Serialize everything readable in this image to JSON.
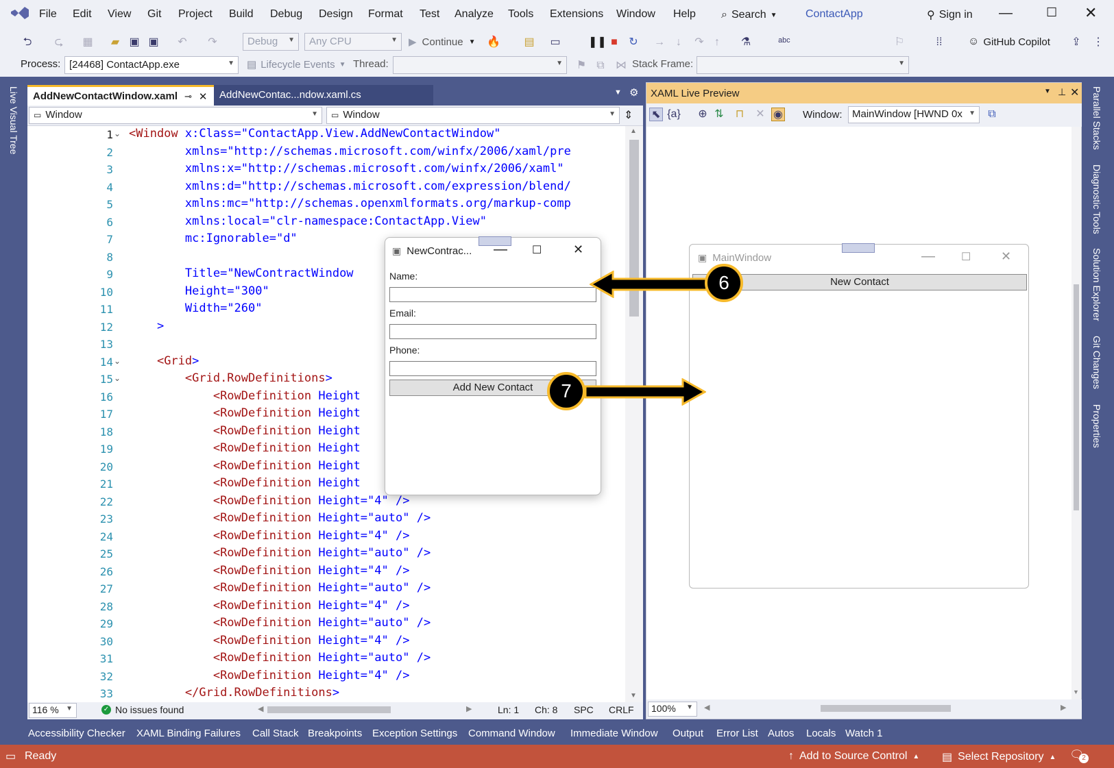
{
  "menu": {
    "items": [
      "File",
      "Edit",
      "View",
      "Git",
      "Project",
      "Build",
      "Debug",
      "Design",
      "Format",
      "Test",
      "Analyze",
      "Tools",
      "Extensions",
      "Window",
      "Help"
    ],
    "search": "Search",
    "app_name": "ContactApp",
    "sign_in": "Sign in"
  },
  "toolbar": {
    "config": "Debug",
    "platform": "Any CPU",
    "continue": "Continue",
    "copilot": "GitHub Copilot"
  },
  "debugbar": {
    "process_label": "Process:",
    "process_value": "[24468] ContactApp.exe",
    "lifecycle": "Lifecycle Events",
    "thread_label": "Thread:",
    "stack_label": "Stack Frame:"
  },
  "left_rail": {
    "label": "Live Visual Tree"
  },
  "editor": {
    "tabs": [
      {
        "label": "AddNewContactWindow.xaml",
        "active": true
      },
      {
        "label": "AddNewContac...ndow.xaml.cs",
        "active": false
      }
    ],
    "nav_left": "Window",
    "nav_right": "Window",
    "lines": [
      {
        "n": "1",
        "text": "<Window x:Class=\"ContactApp.View.AddNewContactWindow\""
      },
      {
        "n": "2",
        "text": "        xmlns=\"http://schemas.microsoft.com/winfx/2006/xaml/pre"
      },
      {
        "n": "3",
        "text": "        xmlns:x=\"http://schemas.microsoft.com/winfx/2006/xaml\""
      },
      {
        "n": "4",
        "text": "        xmlns:d=\"http://schemas.microsoft.com/expression/blend/"
      },
      {
        "n": "5",
        "text": "        xmlns:mc=\"http://schemas.openxmlformats.org/markup-comp"
      },
      {
        "n": "6",
        "text": "        xmlns:local=\"clr-namespace:ContactApp.View\""
      },
      {
        "n": "7",
        "text": "        mc:Ignorable=\"d\""
      },
      {
        "n": "8",
        "text": ""
      },
      {
        "n": "9",
        "text": "        Title=\"NewContractWindow"
      },
      {
        "n": "10",
        "text": "        Height=\"300\""
      },
      {
        "n": "11",
        "text": "        Width=\"260\""
      },
      {
        "n": "12",
        "text": "    >"
      },
      {
        "n": "13",
        "text": ""
      },
      {
        "n": "14",
        "text": "    <Grid>"
      },
      {
        "n": "15",
        "text": "        <Grid.RowDefinitions>"
      },
      {
        "n": "16",
        "text": "            <RowDefinition Height"
      },
      {
        "n": "17",
        "text": "            <RowDefinition Height"
      },
      {
        "n": "18",
        "text": "            <RowDefinition Height"
      },
      {
        "n": "19",
        "text": "            <RowDefinition Height"
      },
      {
        "n": "20",
        "text": "            <RowDefinition Height"
      },
      {
        "n": "21",
        "text": "            <RowDefinition Height"
      },
      {
        "n": "22",
        "text": "            <RowDefinition Height=\"4\" />"
      },
      {
        "n": "23",
        "text": "            <RowDefinition Height=\"auto\" />"
      },
      {
        "n": "24",
        "text": "            <RowDefinition Height=\"4\" />"
      },
      {
        "n": "25",
        "text": "            <RowDefinition Height=\"auto\" />"
      },
      {
        "n": "26",
        "text": "            <RowDefinition Height=\"4\" />"
      },
      {
        "n": "27",
        "text": "            <RowDefinition Height=\"auto\" />"
      },
      {
        "n": "28",
        "text": "            <RowDefinition Height=\"4\" />"
      },
      {
        "n": "29",
        "text": "            <RowDefinition Height=\"auto\" />"
      },
      {
        "n": "30",
        "text": "            <RowDefinition Height=\"4\" />"
      },
      {
        "n": "31",
        "text": "            <RowDefinition Height=\"auto\" />"
      },
      {
        "n": "32",
        "text": "            <RowDefinition Height=\"4\" />"
      },
      {
        "n": "33",
        "text": "        </Grid.RowDefinitions>"
      }
    ],
    "status": {
      "zoom": "116 %",
      "issues": "No issues found",
      "ln": "Ln: 1",
      "ch": "Ch: 8",
      "spc": "SPC",
      "crlf": "CRLF"
    }
  },
  "preview": {
    "title": "XAML Live Preview",
    "window_label": "Window:",
    "window_value": "MainWindow [HWND 0x",
    "zoom": "100%"
  },
  "dialog": {
    "title": "NewContrac...",
    "name_label": "Name:",
    "email_label": "Email:",
    "phone_label": "Phone:",
    "add_button": "Add New Contact"
  },
  "main_window": {
    "title": "MainWindow",
    "new_contact_button": "New Contact"
  },
  "callouts": [
    "6",
    "7"
  ],
  "right_rail": [
    "Parallel Stacks",
    "Diagnostic Tools",
    "Solution Explorer",
    "Git Changes",
    "Properties"
  ],
  "bottom_tabs": [
    "Accessibility Checker",
    "XAML Binding Failures",
    "Call Stack",
    "Breakpoints",
    "Exception Settings",
    "Command Window",
    "Immediate Window",
    "Output",
    "Error List",
    "Autos",
    "Locals",
    "Watch 1"
  ],
  "statusbar": {
    "ready": "Ready",
    "source_control": "Add to Source Control",
    "repository": "Select Repository",
    "notifications": "2"
  },
  "colors": {
    "status": "#c2533c",
    "accent": "#4d5a8c",
    "callout_ring": "#f6b92a"
  }
}
